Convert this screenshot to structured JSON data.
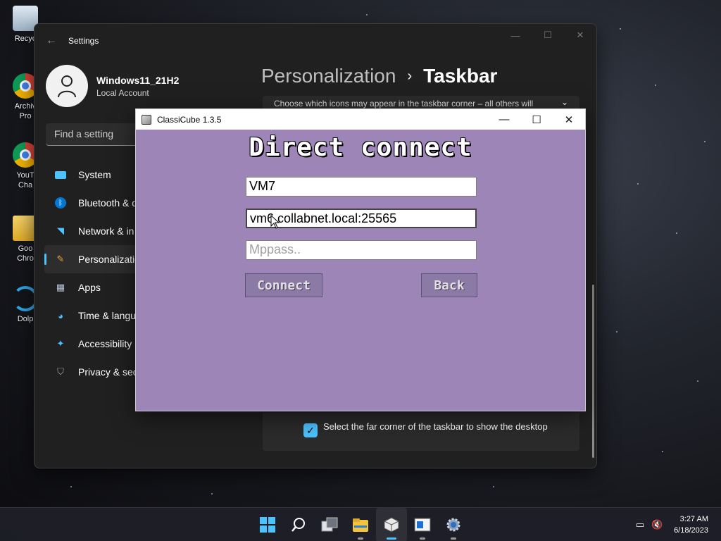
{
  "desktop": {
    "icons": [
      {
        "label": "Recyc"
      },
      {
        "label": "Archiv\nPro"
      },
      {
        "label": "YouT\nCha"
      },
      {
        "label": "Goo\nChro"
      },
      {
        "label": "Dolp"
      }
    ]
  },
  "settings": {
    "title": "Settings",
    "back_icon": "←",
    "user": {
      "name": "Windows11_21H2",
      "account": "Local Account"
    },
    "search_placeholder": "Find a setting",
    "nav": [
      {
        "label": "System",
        "icon": "system-icon"
      },
      {
        "label": "Bluetooth & d",
        "icon": "bluetooth-icon"
      },
      {
        "label": "Network & in",
        "icon": "network-icon"
      },
      {
        "label": "Personalizatio",
        "icon": "brush-icon",
        "active": true
      },
      {
        "label": "Apps",
        "icon": "apps-icon"
      },
      {
        "label": "Time & langu",
        "icon": "time-language-icon"
      },
      {
        "label": "Accessibility",
        "icon": "accessibility-icon"
      },
      {
        "label": "Privacy & secu",
        "icon": "shield-icon"
      }
    ],
    "breadcrumb": {
      "parent": "Personalization",
      "separator": "›",
      "current": "Taskbar"
    },
    "corner_icons_text": "Choose which icons may appear in the taskbar corner – all others will",
    "show_desktop_text": "Select the far corner of the taskbar to show the desktop",
    "show_desktop_checked": true
  },
  "classicube": {
    "title": "ClassiCube 1.3.5",
    "heading": "Direct connect",
    "username_value": "VM7",
    "address_value": "vm6.collabnet.local:25565",
    "mppass_placeholder": "Mppass..",
    "connect_label": "Connect",
    "back_label": "Back",
    "bg_color": "#9d85b7"
  },
  "taskbar": {
    "apps": [
      {
        "name": "start-icon"
      },
      {
        "name": "search-icon"
      },
      {
        "name": "task-view-icon"
      },
      {
        "name": "file-explorer-icon"
      },
      {
        "name": "classicube-icon",
        "active": true
      },
      {
        "name": "window-app-icon"
      },
      {
        "name": "settings-gear-icon"
      }
    ],
    "time": "3:27 AM",
    "date": "6/18/2023"
  }
}
